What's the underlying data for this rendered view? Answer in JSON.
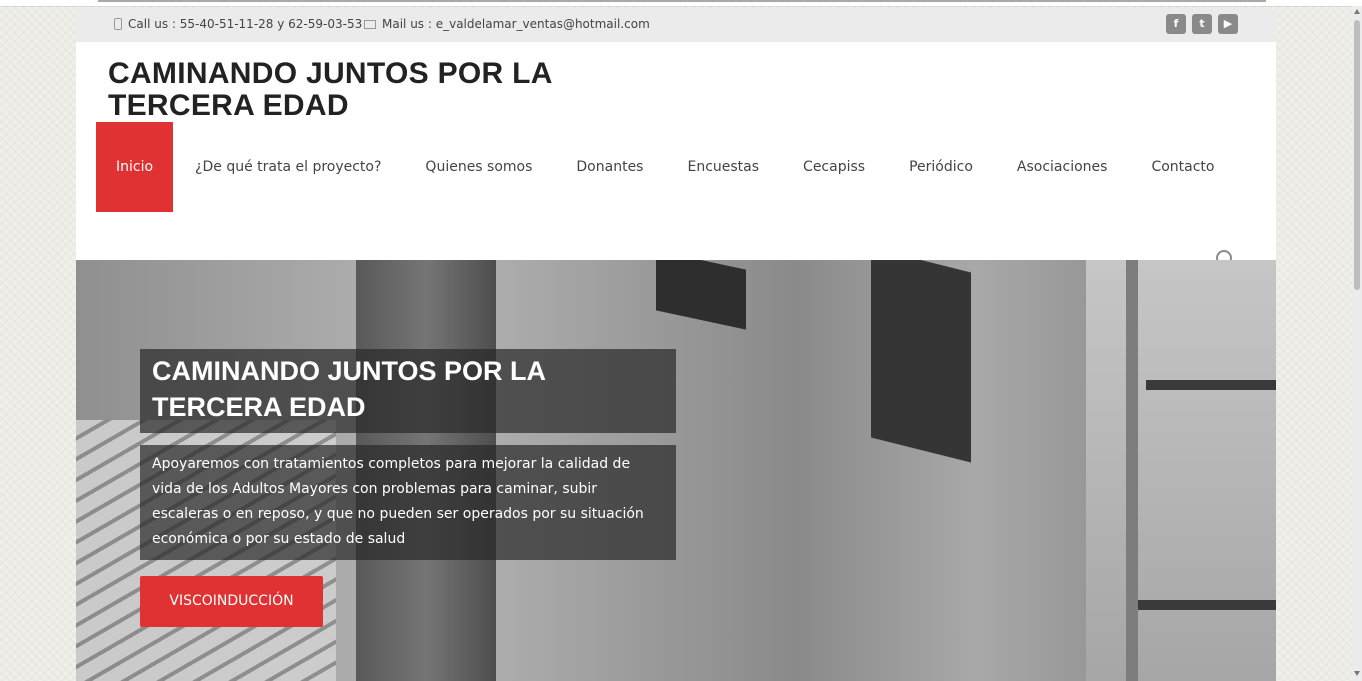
{
  "topbar": {
    "phone": "Call us : 55-40-51-11-28 y 62-59-03-53",
    "mail": "Mail us : e_valdelamar_ventas@hotmail.com",
    "social": [
      {
        "name": "facebook-icon",
        "glyph": "f"
      },
      {
        "name": "twitter-icon",
        "glyph": "t"
      },
      {
        "name": "youtube-icon",
        "glyph": "▶"
      }
    ]
  },
  "header": {
    "title_line1": "CAMINANDO JUNTOS POR LA",
    "title_line2": "TERCERA EDAD"
  },
  "nav": {
    "items": [
      "Inicio",
      "¿De qué trata el proyecto?",
      "Quienes somos",
      "Donantes",
      "Encuestas",
      "Cecapiss",
      "Periódico",
      "Asociaciones",
      "Contacto"
    ],
    "active_index": 0
  },
  "hero": {
    "title": "CAMINANDO JUNTOS POR LA TERCERA EDAD",
    "description": "Apoyaremos con tratamientos completos para mejorar la calidad de vida de los Adultos Mayores con problemas para caminar, subir escaleras o en reposo, y que no pueden ser operados por su situación económica o por su estado de salud",
    "button": "VISCOINDUCCIÓN"
  },
  "colors": {
    "accent": "#e03232",
    "topbar_bg": "#ebebeb",
    "text": "#444444"
  }
}
